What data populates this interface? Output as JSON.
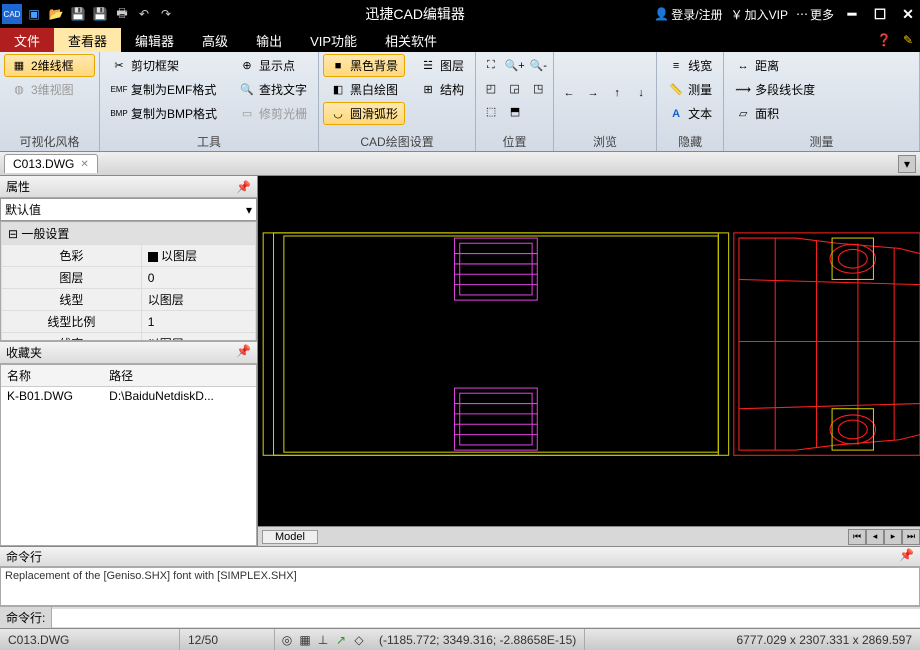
{
  "title": "迅捷CAD编辑器",
  "titlebar_right": {
    "login": "登录/注册",
    "vip": "加入VIP",
    "more": "更多"
  },
  "menu": {
    "file": "文件",
    "viewer": "查看器",
    "editor": "编辑器",
    "advanced": "高级",
    "output": "输出",
    "vip": "VIP功能",
    "related": "相关软件"
  },
  "ribbon": {
    "g1": {
      "label": "可视化风格",
      "wire2d": "2维线框",
      "wire3d": "3维视图"
    },
    "g2": {
      "label": "工具",
      "clip": "剪切框架",
      "emf": "复制为EMF格式",
      "bmp": "复制为BMP格式",
      "showpt": "显示点",
      "findtxt": "查找文字",
      "trimhl": "修剪光栅"
    },
    "g3": {
      "label": "CAD绘图设置",
      "blackbg": "黑色背景",
      "bwdraw": "黑白绘图",
      "arc": "圆滑弧形",
      "layer": "图层",
      "struct": "结构"
    },
    "g4": {
      "label": "位置"
    },
    "g5": {
      "label": "浏览"
    },
    "g6": {
      "label": "隐藏",
      "linew": "线宽",
      "measure": "测量",
      "text": "文本"
    },
    "g7": {
      "label": "测量",
      "dist": "距离",
      "polylen": "多段线长度",
      "area": "面积"
    }
  },
  "doc_tab": "C013.DWG",
  "props": {
    "title": "属性",
    "default": "默认值",
    "section": "一般设置",
    "rows": [
      {
        "k": "色彩",
        "v": "以图层"
      },
      {
        "k": "图层",
        "v": "0"
      },
      {
        "k": "线型",
        "v": "以图层"
      },
      {
        "k": "线型比例",
        "v": "1"
      },
      {
        "k": "线宽",
        "v": "以图层"
      }
    ]
  },
  "fav": {
    "title": "收藏夹",
    "col1": "名称",
    "col2": "路径",
    "name": "K-B01.DWG",
    "path": "D:\\BaiduNetdiskD..."
  },
  "model_tab": "Model",
  "cmd": {
    "title": "命令行",
    "log": "Replacement of the [Geniso.SHX] font with [SIMPLEX.SHX]",
    "prompt": "命令行:"
  },
  "status": {
    "file": "C013.DWG",
    "count": "12/50",
    "coords": "(-1185.772; 3349.316; -2.88658E-15)",
    "dims": "6777.029 x 2307.331 x 2869.597"
  }
}
